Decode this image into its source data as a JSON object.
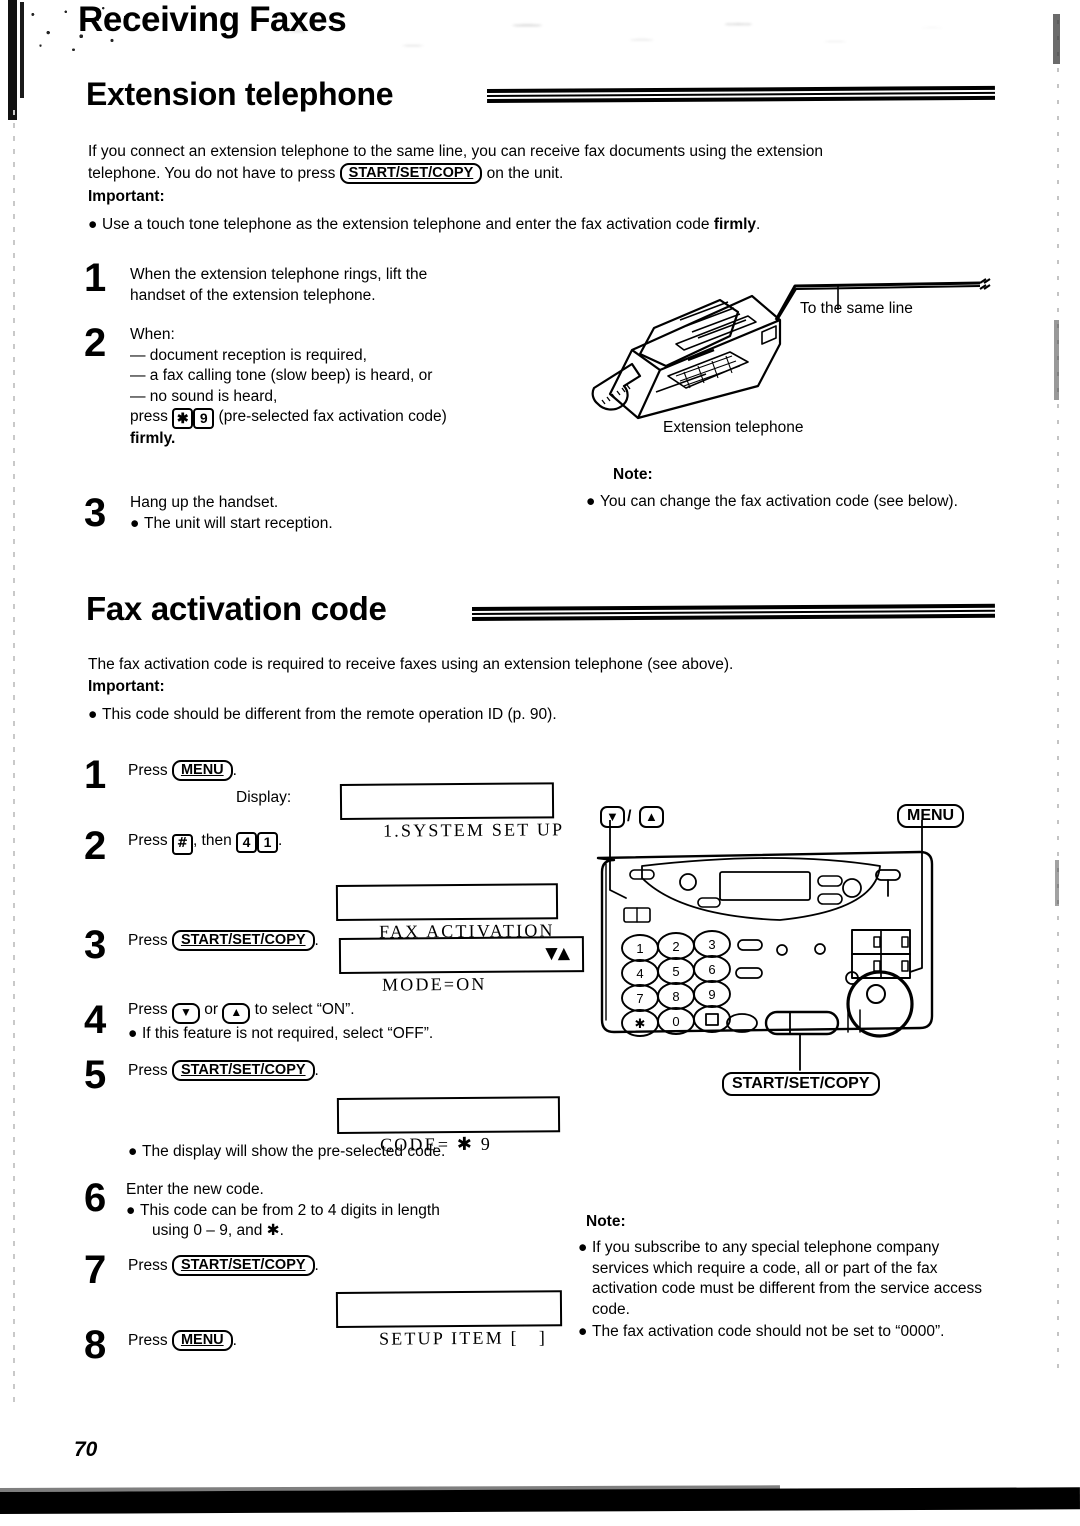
{
  "chapter": {
    "title": "Receiving Faxes"
  },
  "section1": {
    "heading": "Extension telephone",
    "intro_line1": "If you connect an extension telephone to the same line, you can receive fax documents using the extension",
    "intro_line2_a": "telephone. You do not have to press",
    "intro_key": "START/SET/COPY",
    "intro_line2_b": "on the unit.",
    "important_label": "Important:",
    "important_bullet_a": "Use a touch tone telephone as the extension telephone and enter the fax activation code ",
    "important_bullet_b": "firmly",
    "important_bullet_c": ".",
    "steps": [
      {
        "num": "1",
        "lines": [
          "When the extension telephone rings, lift the",
          "handset of the extension telephone."
        ]
      },
      {
        "num": "2",
        "lines": [
          "When:",
          "— document reception is required,",
          "— a fax calling tone (slow beep) is heard, or",
          "— no sound is heard,"
        ],
        "press_prefix": "press",
        "key_star": "✱",
        "key_nine": "9",
        "press_suffix": "(pre-selected fax activation code)",
        "press_bold": "firmly."
      },
      {
        "num": "3",
        "lines": [
          "Hang up the handset."
        ],
        "bullet": "The unit will start reception."
      }
    ],
    "illustration": {
      "to_same_line_label": "To the same line",
      "extension_telephone_label": "Extension telephone"
    },
    "note": {
      "label": "Note:",
      "bullets": [
        "You can change the fax activation code (see below)."
      ]
    }
  },
  "section2": {
    "heading": "Fax activation code",
    "intro": "The fax activation code is required to receive faxes using an extension telephone (see above).",
    "important_label": "Important:",
    "important_bullet": "This code should be different from the remote operation ID (p. 90).",
    "display_label": "Display:",
    "steps": [
      {
        "num": "1",
        "text_prefix": "Press",
        "key": "MENU",
        "text_suffix": "."
      },
      {
        "num": "2",
        "text_prefix": "Press",
        "key_hash": "#",
        "text_mid": ", then",
        "key_4": "4",
        "key_1": "1",
        "text_suffix": "."
      },
      {
        "num": "3",
        "text_prefix": "Press",
        "key": "START/SET/COPY",
        "text_suffix": "."
      },
      {
        "num": "4",
        "text_prefix": "Press",
        "key_down": "▼",
        "text_or": "or",
        "key_up": "▲",
        "text_suffix": "to select “ON”.",
        "bullet": "If this feature is not required, select “OFF”."
      },
      {
        "num": "5",
        "text_prefix": "Press",
        "key": "START/SET/COPY",
        "text_suffix": ".",
        "bullet": "The display will show the pre-selected code."
      },
      {
        "num": "6",
        "text_prefix": "Enter the new code.",
        "bullet_line1": "This code can be from 2 to 4 digits in length",
        "bullet_line2": "using 0 – 9, and ✱."
      },
      {
        "num": "7",
        "text_prefix": "Press",
        "key": "START/SET/COPY",
        "text_suffix": "."
      },
      {
        "num": "8",
        "text_prefix": "Press",
        "key": "MENU",
        "text_suffix": "."
      }
    ],
    "displays": [
      {
        "name": "system-set-up",
        "text": "1.SYSTEM SET UP"
      },
      {
        "name": "fax-activation",
        "text": "FAX ACTIVATION"
      },
      {
        "name": "mode-on",
        "text": "MODE=ON",
        "arrows": "▼▲"
      },
      {
        "name": "code",
        "text": "CODE= ✱ 9"
      },
      {
        "name": "setup-item",
        "text": "SETUP ITEM [   ]"
      }
    ],
    "illustration": {
      "nav_callout_down": "▼",
      "nav_callout_sep": "/",
      "nav_callout_up": "▲",
      "menu_callout": "MENU",
      "start_callout": "START/SET/COPY",
      "keypad": [
        "1",
        "2",
        "3",
        "4",
        "5",
        "6",
        "7",
        "8",
        "9",
        "✱",
        "0",
        "▣"
      ]
    },
    "note": {
      "label": "Note:",
      "bullets": [
        "If you subscribe to any special telephone company services which require a code, all or part of the fax activation code must be different from the service access code.",
        "The fax activation code should not be set to “0000”."
      ]
    }
  },
  "footer": {
    "page_number": "70"
  }
}
